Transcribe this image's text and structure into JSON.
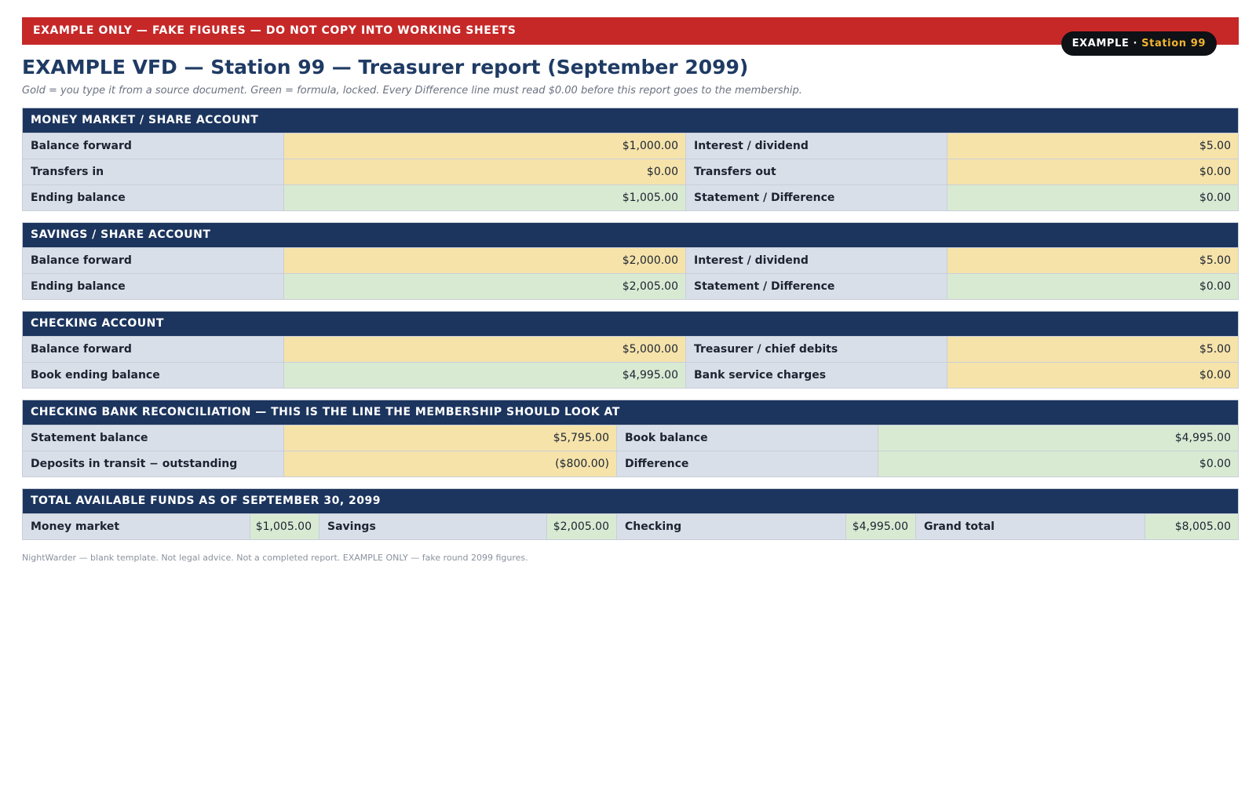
{
  "banner": {
    "text": "EXAMPLE ONLY — FAKE FIGURES — DO NOT COPY INTO WORKING SHEETS"
  },
  "pill": {
    "label": "EXAMPLE ·",
    "station": "Station 99"
  },
  "title": "EXAMPLE VFD — Station 99 — Treasurer report (September 2099)",
  "subtitle": "Gold = you type it from a source document. Green = formula, locked. Every Difference line must read $0.00 before this report goes to the membership.",
  "colors": {
    "banner": "#c62828",
    "header": "#1c355e",
    "gold_input": "#f6e3aa",
    "green_formula": "#d9ead3",
    "label": "#d8dfe9"
  },
  "money_market": {
    "heading": "MONEY MARKET / SHARE ACCOUNT",
    "balance_forward_label": "Balance forward",
    "balance_forward": "$1,000.00",
    "interest_label": "Interest / dividend",
    "interest": "$5.00",
    "transfers_in_label": "Transfers in",
    "transfers_in": "$0.00",
    "transfers_out_label": "Transfers out",
    "transfers_out": "$0.00",
    "ending_label": "Ending balance",
    "ending": "$1,005.00",
    "difference_label": "Statement / Difference",
    "difference": "$0.00"
  },
  "savings": {
    "heading": "SAVINGS / SHARE ACCOUNT",
    "balance_forward_label": "Balance forward",
    "balance_forward": "$2,000.00",
    "interest_label": "Interest / dividend",
    "interest": "$5.00",
    "ending_label": "Ending balance",
    "ending": "$2,005.00",
    "difference_label": "Statement / Difference",
    "difference": "$0.00"
  },
  "checking": {
    "heading": "CHECKING ACCOUNT",
    "balance_forward_label": "Balance forward",
    "balance_forward": "$5,000.00",
    "debits_label": "Treasurer / chief debits",
    "debits": "$5.00",
    "book_ending_label": "Book ending balance",
    "book_ending": "$4,995.00",
    "charges_label": "Bank service charges",
    "charges": "$0.00"
  },
  "reconciliation": {
    "heading": "CHECKING BANK RECONCILIATION — THIS IS THE LINE THE MEMBERSHIP SHOULD LOOK AT",
    "statement_label": "Statement balance",
    "statement": "$5,795.00",
    "book_label": "Book balance",
    "book": "$4,995.00",
    "deposits_label": "Deposits in transit − outstanding",
    "deposits": "($800.00)",
    "difference_label": "Difference",
    "difference": "$0.00"
  },
  "totals": {
    "heading": "TOTAL AVAILABLE FUNDS AS OF SEPTEMBER 30, 2099",
    "money_market_label": "Money market",
    "money_market": "$1,005.00",
    "savings_label": "Savings",
    "savings": "$2,005.00",
    "checking_label": "Checking",
    "checking": "$4,995.00",
    "grand_label": "Grand total",
    "grand": "$8,005.00"
  },
  "footnote": "NightWarder — blank template. Not legal advice. Not a completed report. EXAMPLE ONLY — fake round 2099 figures."
}
